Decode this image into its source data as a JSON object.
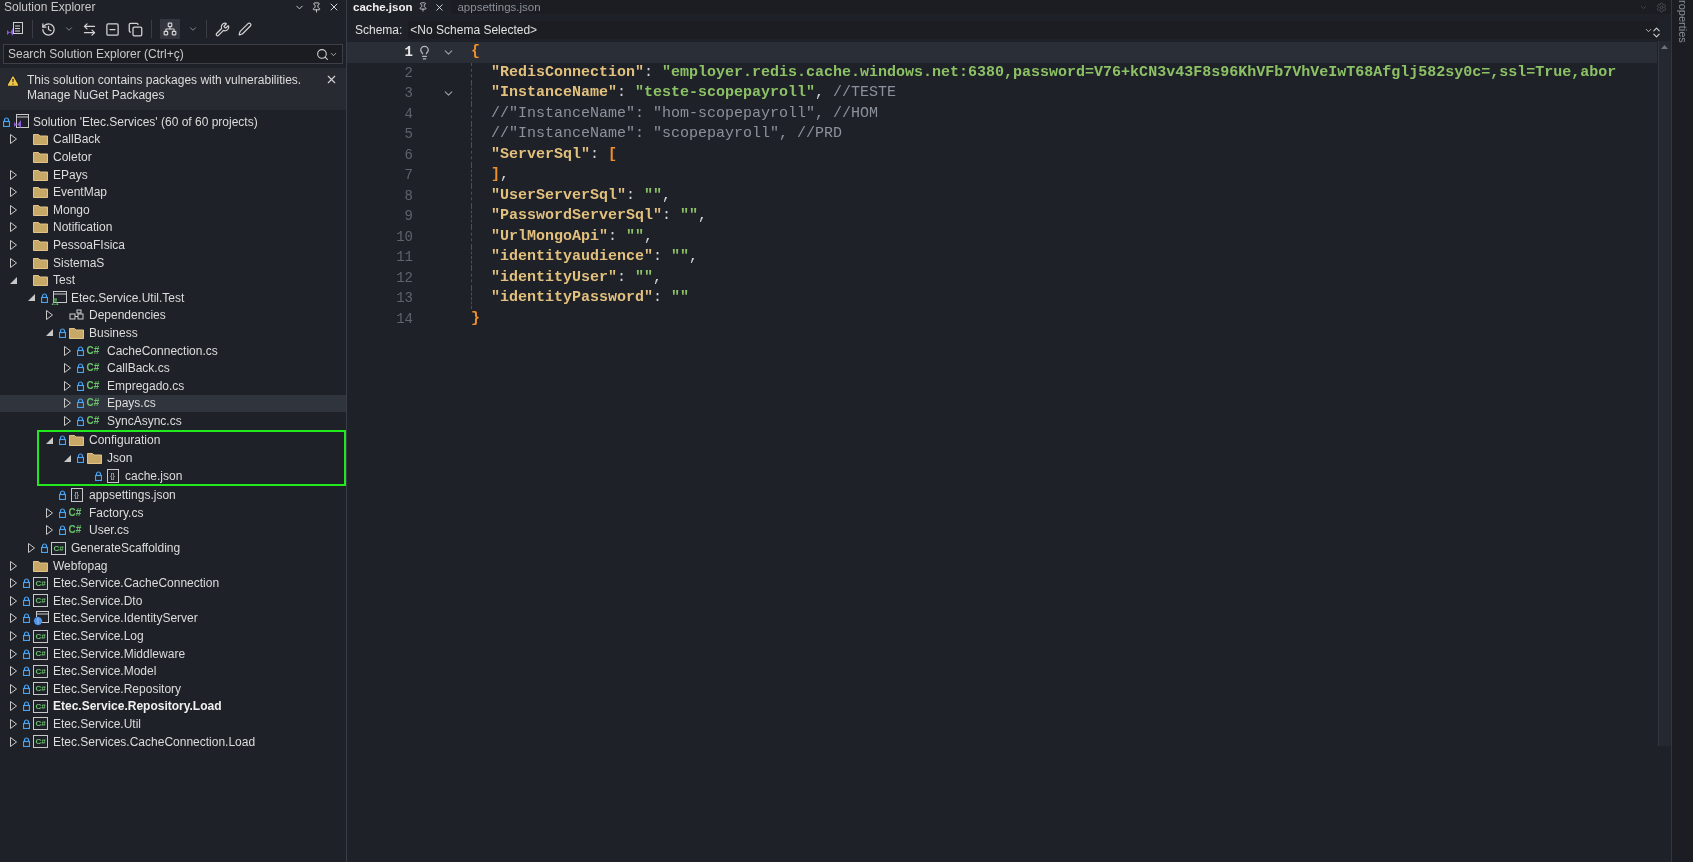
{
  "solution_explorer": {
    "title": "Solution Explorer",
    "search": {
      "placeholder": "Search Solution Explorer (Ctrl+ç)"
    },
    "notice": {
      "message": "This solution contains packages with vulnerabilities.",
      "link": "Manage NuGet Packages"
    },
    "tree": {
      "label": "Solution 'Etec.Services' (60 of 60 projects)",
      "kind": "solution",
      "locked": true,
      "selected": false,
      "bold": false,
      "children": [
        {
          "label": "CallBack",
          "kind": "folder",
          "expanded": false,
          "locked": false,
          "selected": false,
          "bold": false
        },
        {
          "label": "Coletor",
          "kind": "folder",
          "locked": false,
          "selected": false,
          "bold": false
        },
        {
          "label": "EPays",
          "kind": "folder",
          "expanded": false,
          "locked": false,
          "selected": false,
          "bold": false
        },
        {
          "label": "EventMap",
          "kind": "folder",
          "expanded": false,
          "locked": false,
          "selected": false,
          "bold": false
        },
        {
          "label": "Mongo",
          "kind": "folder",
          "expanded": false,
          "locked": false,
          "selected": false,
          "bold": false
        },
        {
          "label": "Notification",
          "kind": "folder",
          "expanded": false,
          "locked": false,
          "selected": false,
          "bold": false
        },
        {
          "label": "PessoaFIsica",
          "kind": "folder",
          "expanded": false,
          "locked": false,
          "selected": false,
          "bold": false
        },
        {
          "label": "SistemaS",
          "kind": "folder",
          "expanded": false,
          "locked": false,
          "selected": false,
          "bold": false
        },
        {
          "label": "Test",
          "kind": "folder",
          "expanded": true,
          "locked": false,
          "selected": false,
          "bold": false,
          "children": [
            {
              "label": "Etec.Service.Util.Test",
              "kind": "test-project",
              "expanded": true,
              "locked": true,
              "selected": false,
              "bold": false,
              "children": [
                {
                  "label": "Dependencies",
                  "kind": "dependencies",
                  "expanded": false,
                  "locked": false,
                  "selected": false,
                  "bold": false
                },
                {
                  "label": "Business",
                  "kind": "folder",
                  "expanded": true,
                  "locked": true,
                  "selected": false,
                  "bold": false,
                  "children": [
                    {
                      "label": "CacheConnection.cs",
                      "kind": "csharp",
                      "badge": "C#",
                      "expanded": false,
                      "locked": true,
                      "selected": false,
                      "bold": false
                    },
                    {
                      "label": "CallBack.cs",
                      "kind": "csharp",
                      "badge": "C#",
                      "expanded": false,
                      "locked": true,
                      "selected": false,
                      "bold": false
                    },
                    {
                      "label": "Empregado.cs",
                      "kind": "csharp",
                      "badge": "C#",
                      "expanded": false,
                      "locked": true,
                      "selected": false,
                      "bold": false
                    },
                    {
                      "label": "Epays.cs",
                      "kind": "csharp",
                      "badge": "C#",
                      "expanded": false,
                      "locked": true,
                      "selected": true,
                      "bold": false
                    },
                    {
                      "label": "SyncAsync.cs",
                      "kind": "csharp",
                      "badge": "C#",
                      "expanded": false,
                      "locked": true,
                      "selected": false,
                      "bold": false
                    }
                  ]
                },
                {
                  "label": "Configuration",
                  "kind": "folder",
                  "expanded": true,
                  "locked": true,
                  "selected": false,
                  "bold": false,
                  "framed": true,
                  "children": [
                    {
                      "label": "Json",
                      "kind": "folder",
                      "expanded": true,
                      "locked": true,
                      "selected": false,
                      "bold": false,
                      "children": [
                        {
                          "label": "cache.json",
                          "kind": "json",
                          "badge": "{}",
                          "locked": true,
                          "selected": false,
                          "bold": false
                        }
                      ]
                    }
                  ]
                },
                {
                  "label": "appsettings.json",
                  "kind": "json",
                  "badge": "{}",
                  "locked": true,
                  "selected": false,
                  "bold": false
                },
                {
                  "label": "Factory.cs",
                  "kind": "csharp",
                  "badge": "C#",
                  "expanded": false,
                  "locked": true,
                  "selected": false,
                  "bold": false
                },
                {
                  "label": "User.cs",
                  "kind": "csharp",
                  "badge": "C#",
                  "expanded": false,
                  "locked": true,
                  "selected": false,
                  "bold": false
                }
              ]
            },
            {
              "label": "GenerateScaffolding",
              "kind": "project",
              "badge": "C#",
              "expanded": false,
              "locked": true,
              "selected": false,
              "bold": false
            }
          ]
        },
        {
          "label": "Webfopag",
          "kind": "folder",
          "expanded": false,
          "locked": false,
          "selected": false,
          "bold": false
        },
        {
          "label": "Etec.Service.CacheConnection",
          "kind": "project",
          "badge": "C#",
          "expanded": false,
          "locked": true,
          "selected": false,
          "bold": false
        },
        {
          "label": "Etec.Service.Dto",
          "kind": "project",
          "badge": "C#",
          "expanded": false,
          "locked": true,
          "selected": false,
          "bold": false
        },
        {
          "label": "Etec.Service.IdentityServer",
          "kind": "web-project",
          "expanded": false,
          "locked": true,
          "selected": false,
          "bold": false
        },
        {
          "label": "Etec.Service.Log",
          "kind": "project",
          "badge": "C#",
          "expanded": false,
          "locked": true,
          "selected": false,
          "bold": false
        },
        {
          "label": "Etec.Service.Middleware",
          "kind": "project",
          "badge": "C#",
          "expanded": false,
          "locked": true,
          "selected": false,
          "bold": false
        },
        {
          "label": "Etec.Service.Model",
          "kind": "project",
          "badge": "C#",
          "expanded": false,
          "locked": true,
          "selected": false,
          "bold": false
        },
        {
          "label": "Etec.Service.Repository",
          "kind": "project",
          "badge": "C#",
          "expanded": false,
          "locked": true,
          "selected": false,
          "bold": false
        },
        {
          "label": "Etec.Service.Repository.Load",
          "kind": "project",
          "badge": "C#",
          "expanded": false,
          "locked": true,
          "selected": false,
          "bold": true
        },
        {
          "label": "Etec.Service.Util",
          "kind": "project",
          "badge": "C#",
          "expanded": false,
          "locked": true,
          "selected": false,
          "bold": false
        },
        {
          "label": "Etec.Services.CacheConnection.Load",
          "kind": "project",
          "badge": "C#",
          "expanded": false,
          "locked": true,
          "selected": false,
          "bold": false
        }
      ]
    }
  },
  "editor": {
    "tabs": [
      {
        "label": "cache.json",
        "selected": true
      },
      {
        "label": "appsettings.json",
        "selected": false
      }
    ],
    "schema": {
      "label": "Schema:",
      "value": "<No Schema Selected>"
    },
    "lines": [
      {
        "number": "1",
        "current": true,
        "foldable": true,
        "indented": false,
        "tokens": [
          {
            "kind": "bracket",
            "text": "{"
          }
        ]
      },
      {
        "number": "2",
        "current": false,
        "foldable": false,
        "indented": true,
        "tokens": [
          {
            "kind": "key",
            "text": "\"RedisConnection\""
          },
          {
            "kind": "punct",
            "text": ": "
          },
          {
            "kind": "string",
            "text": "\"employer.redis.cache.windows.net:6380,password=V76+kCN3v43F8s96KhVFb7VhVeIwT68Afglj582sy0c=,ssl=True,abor"
          }
        ]
      },
      {
        "number": "3",
        "current": false,
        "foldable": true,
        "indented": true,
        "tokens": [
          {
            "kind": "key",
            "text": "\"InstanceName\""
          },
          {
            "kind": "punct",
            "text": ": "
          },
          {
            "kind": "string",
            "text": "\"teste-scopepayroll\""
          },
          {
            "kind": "punct",
            "text": ", "
          },
          {
            "kind": "comment",
            "text": "//TESTE"
          }
        ]
      },
      {
        "number": "4",
        "current": false,
        "foldable": false,
        "indented": true,
        "tokens": [
          {
            "kind": "comment",
            "text": "//\"InstanceName\": \"hom-scopepayroll\", //HOM"
          }
        ]
      },
      {
        "number": "5",
        "current": false,
        "foldable": false,
        "indented": true,
        "tokens": [
          {
            "kind": "comment",
            "text": "//\"InstanceName\": \"scopepayroll\", //PRD"
          }
        ]
      },
      {
        "number": "6",
        "current": false,
        "foldable": false,
        "indented": true,
        "tokens": [
          {
            "kind": "key",
            "text": "\"ServerSql\""
          },
          {
            "kind": "punct",
            "text": ": "
          },
          {
            "kind": "bracket",
            "text": "["
          }
        ]
      },
      {
        "number": "7",
        "current": false,
        "foldable": false,
        "indented": true,
        "tokens": [
          {
            "kind": "bracket",
            "text": "]"
          },
          {
            "kind": "punct",
            "text": ","
          }
        ]
      },
      {
        "number": "8",
        "current": false,
        "foldable": false,
        "indented": true,
        "tokens": [
          {
            "kind": "key",
            "text": "\"UserServerSql\""
          },
          {
            "kind": "punct",
            "text": ": "
          },
          {
            "kind": "string",
            "text": "\"\""
          },
          {
            "kind": "punct",
            "text": ","
          }
        ]
      },
      {
        "number": "9",
        "current": false,
        "foldable": false,
        "indented": true,
        "tokens": [
          {
            "kind": "key",
            "text": "\"PasswordServerSql\""
          },
          {
            "kind": "punct",
            "text": ": "
          },
          {
            "kind": "string",
            "text": "\"\""
          },
          {
            "kind": "punct",
            "text": ","
          }
        ]
      },
      {
        "number": "10",
        "current": false,
        "foldable": false,
        "indented": true,
        "tokens": [
          {
            "kind": "key",
            "text": "\"UrlMongoApi\""
          },
          {
            "kind": "punct",
            "text": ": "
          },
          {
            "kind": "string",
            "text": "\"\""
          },
          {
            "kind": "punct",
            "text": ","
          }
        ]
      },
      {
        "number": "11",
        "current": false,
        "foldable": false,
        "indented": true,
        "tokens": [
          {
            "kind": "key",
            "text": "\"identityaudience\""
          },
          {
            "kind": "punct",
            "text": ": "
          },
          {
            "kind": "string",
            "text": "\"\""
          },
          {
            "kind": "punct",
            "text": ","
          }
        ]
      },
      {
        "number": "12",
        "current": false,
        "foldable": false,
        "indented": true,
        "tokens": [
          {
            "kind": "key",
            "text": "\"identityUser\""
          },
          {
            "kind": "punct",
            "text": ": "
          },
          {
            "kind": "string",
            "text": "\"\""
          },
          {
            "kind": "punct",
            "text": ","
          }
        ]
      },
      {
        "number": "13",
        "current": false,
        "foldable": false,
        "indented": true,
        "tokens": [
          {
            "kind": "key",
            "text": "\"identityPassword\""
          },
          {
            "kind": "punct",
            "text": ": "
          },
          {
            "kind": "string",
            "text": "\"\""
          }
        ]
      },
      {
        "number": "14",
        "current": false,
        "foldable": false,
        "indented": false,
        "tokens": [
          {
            "kind": "bracket",
            "text": "}"
          }
        ]
      }
    ]
  },
  "properties_panel": {
    "label": "roperties"
  }
}
